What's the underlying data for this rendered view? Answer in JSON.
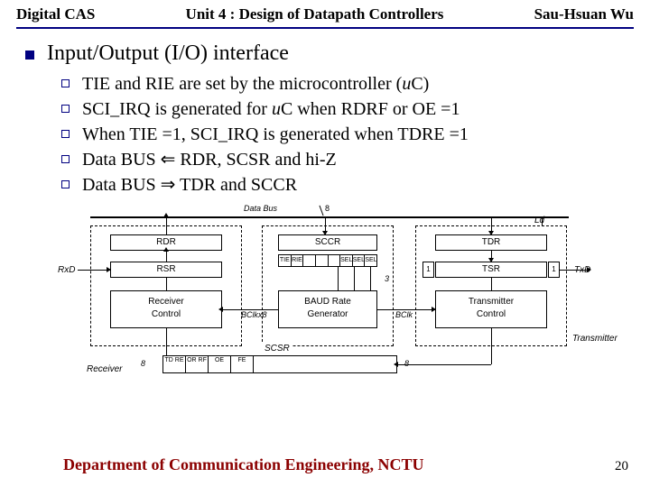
{
  "header": {
    "left": "Digital CAS",
    "center": "Unit 4 : Design of Datapath Controllers",
    "right": "Sau-Hsuan Wu"
  },
  "title_line": "Input/Output (I/O) interface",
  "bullets": [
    {
      "pre": "TIE and RIE are set by the microcontroller (",
      "it": "u",
      "post": "C)"
    },
    {
      "pre": "SCI_IRQ is generated for ",
      "it": "u",
      "post": "C when RDRF or OE =1"
    },
    {
      "pre": "When TIE =1, SCI_IRQ is generated when TDRE =1",
      "it": "",
      "post": ""
    },
    {
      "pre": "Data BUS ⇐ RDR, SCSR and hi-Z",
      "it": "",
      "post": ""
    },
    {
      "pre": "Data BUS ⇒ TDR and SCCR",
      "it": "",
      "post": ""
    }
  ],
  "diagram": {
    "bus_label": "Data Bus",
    "bus_width": "8",
    "rx": {
      "rdr": "RDR",
      "rsr": "RSR",
      "ctrl": "Receiver\nControl",
      "label": "Receiver",
      "rxd": "RxD"
    },
    "baud": {
      "sccr": "SCCR",
      "cells": [
        "TIE",
        "RIE",
        "",
        "",
        "",
        "SEL2",
        "SEL1",
        "SEL0"
      ],
      "gen": "BAUD Rate\nGenerator",
      "sel2": "SEL\n2",
      "sel1": "SEL\n1",
      "sel0": "SEL\n0",
      "three": "3",
      "bclkx8": "BClkx8",
      "bclk": "BClk"
    },
    "tx": {
      "tdr": "TDR",
      "tsr": "TSR",
      "ctrl": "Transmitter\nControl",
      "label": "Transmitter",
      "txd": "TxD",
      "one": "1",
      "ld": "Ld"
    },
    "scsr": {
      "name": "SCSR",
      "cells": [
        "TD\nRE",
        "OR\nRF",
        "OE",
        "FE",
        "",
        "",
        "",
        ""
      ],
      "eight_a": "8",
      "eight_b": "8"
    }
  },
  "footer": {
    "dept": "Department of Communication Engineering, NCTU",
    "page": "20"
  }
}
